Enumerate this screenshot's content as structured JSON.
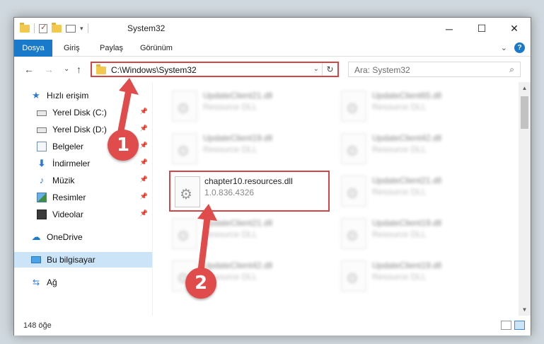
{
  "window": {
    "title": "System32",
    "controls": {
      "minimize": "─",
      "maximize": "☐",
      "close": "✕"
    }
  },
  "ribbon": {
    "tabs": [
      "Dosya",
      "Giriş",
      "Paylaş",
      "Görünüm"
    ],
    "collapse_glyph": "⌄",
    "help_glyph": "?"
  },
  "nav": {
    "back": "←",
    "forward": "→",
    "recent": "⌄",
    "up": "↑"
  },
  "address": {
    "path": "C:\\Windows\\System32",
    "dropdown_glyph": "⌄",
    "refresh_glyph": "↻"
  },
  "search": {
    "placeholder": "Ara: System32",
    "icon_glyph": "⌕"
  },
  "sidebar": {
    "items": [
      {
        "label": "Hızlı erişim",
        "icon": "quick-access-star-icon",
        "glyph": "★",
        "pinned": false
      },
      {
        "label": "Yerel Disk (C:)",
        "icon": "local-disk-icon",
        "glyph": "",
        "pinned": true
      },
      {
        "label": "Yerel Disk (D:)",
        "icon": "local-disk-icon",
        "glyph": "",
        "pinned": true
      },
      {
        "label": "Belgeler",
        "icon": "documents-icon",
        "glyph": "",
        "pinned": true
      },
      {
        "label": "İndirmeler",
        "icon": "downloads-arrow-icon",
        "glyph": "⬇",
        "pinned": true
      },
      {
        "label": "Müzik",
        "icon": "music-note-icon",
        "glyph": "♪",
        "pinned": true
      },
      {
        "label": "Resimler",
        "icon": "pictures-icon",
        "glyph": "",
        "pinned": true
      },
      {
        "label": "Videolar",
        "icon": "videos-icon",
        "glyph": "",
        "pinned": true
      },
      {
        "label": "OneDrive",
        "icon": "onedrive-cloud-icon",
        "glyph": "☁",
        "pinned": false
      },
      {
        "label": "Bu bilgisayar",
        "icon": "this-pc-icon",
        "glyph": "",
        "pinned": false,
        "selected": true
      },
      {
        "label": "Ağ",
        "icon": "network-icon",
        "glyph": "⇆",
        "pinned": false
      }
    ],
    "pin_glyph": "📌"
  },
  "files": {
    "highlighted": {
      "name": "chapter10.resources.dll",
      "version": "1.0.836.4326"
    },
    "blurred": [
      {
        "name": "UpdateClient21.dll",
        "type": "Resource DLL"
      },
      {
        "name": "UpdateClient65.dll",
        "type": "Resource DLL"
      },
      {
        "name": "UpdateClient19.dll",
        "type": "Resource DLL"
      },
      {
        "name": "UpdateClient42.dll",
        "type": "Resource DLL"
      },
      {
        "name": "UpdateClient21.dll",
        "type": "Resource DLL"
      },
      {
        "name": "UpdateClient21.dll",
        "type": "Resource DLL"
      },
      {
        "name": "UpdateClient19.dll",
        "type": "Resource DLL"
      },
      {
        "name": "UpdateClient42.dll",
        "type": "Resource DLL"
      },
      {
        "name": "UpdateClient19.dll",
        "type": "Resource DLL"
      }
    ]
  },
  "status": {
    "item_count": "148 öğe"
  },
  "annotations": {
    "step1": "1",
    "step2": "2",
    "color": "#e04b4b"
  }
}
